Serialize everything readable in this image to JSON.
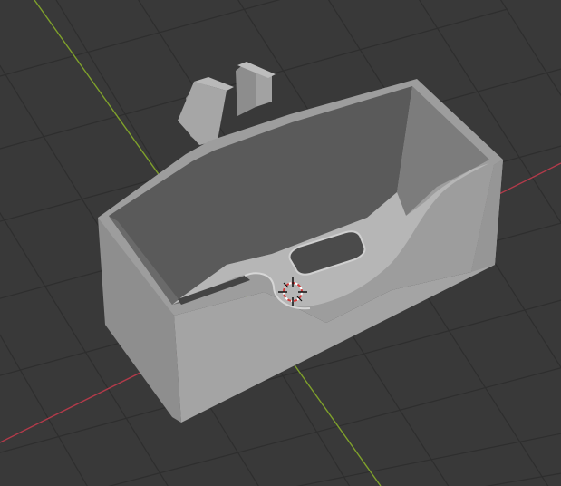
{
  "viewport": {
    "background_color": "#393939",
    "grid_color": "#2e2e2e",
    "x_axis_color": "#b23a4a",
    "y_axis_color": "#7fa12b",
    "model_colors": {
      "top_face": "#9d9d9d",
      "front_face": "#a4a4a4",
      "side_face": "#8e8e8e",
      "inner_wall": "#5a5a5a",
      "inner_floor": "#b6b6b6",
      "slot": "#444444"
    },
    "origin_marker_icon": "3d-cursor-icon"
  }
}
